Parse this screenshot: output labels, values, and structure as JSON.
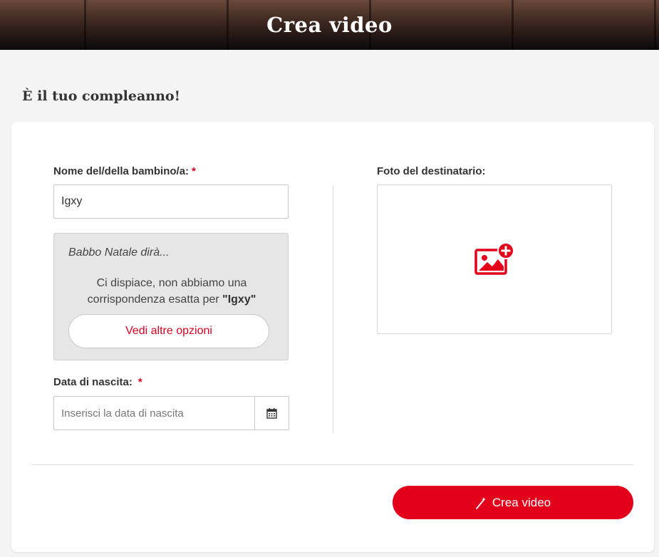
{
  "header": {
    "title": "Crea video"
  },
  "page": {
    "subtitle": "È il tuo compleanno!"
  },
  "form": {
    "name_label": "Nome del/della bambino/a:",
    "required_mark": "*",
    "name_value": "Igxy",
    "santa": {
      "heading": "Babbo Natale dirà...",
      "message_prefix": "Ci dispiace, non abbiamo una corrispondenza esatta per ",
      "message_name": "\"Igxy\"",
      "more_options_label": "Vedi altre opzioni"
    },
    "birth_label": "Data di nascita:",
    "birth_placeholder": "Inserisci la data di nascita",
    "photo_label": "Foto del destinatario:",
    "create_label": "Crea video"
  },
  "icons": {
    "calendar": "calendar-icon",
    "add_photo": "add-photo-icon",
    "magic_wand": "magic-wand-icon"
  },
  "colors": {
    "accent": "#e3001b",
    "required": "#d8001e"
  }
}
